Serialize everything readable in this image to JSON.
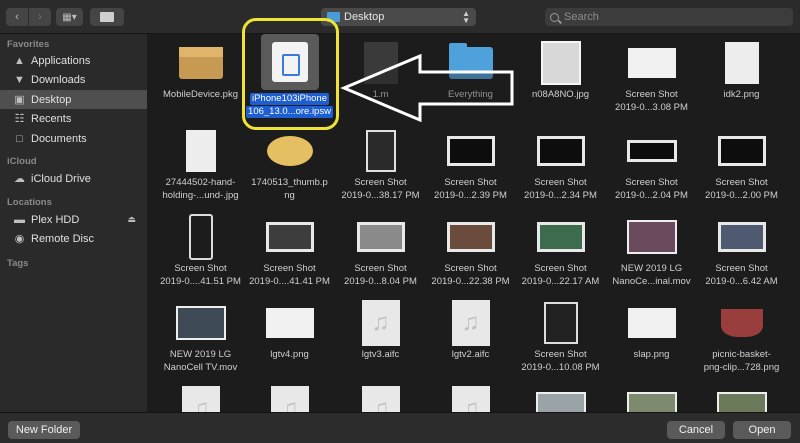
{
  "toolbar": {
    "location": "Desktop",
    "search_placeholder": "Search"
  },
  "sidebar": {
    "favorites_header": "Favorites",
    "favorites": [
      {
        "label": "Applications",
        "icon": "applications-icon"
      },
      {
        "label": "Downloads",
        "icon": "downloads-icon"
      },
      {
        "label": "Desktop",
        "icon": "desktop-icon",
        "selected": true
      },
      {
        "label": "Recents",
        "icon": "recents-icon"
      },
      {
        "label": "Documents",
        "icon": "documents-icon"
      }
    ],
    "icloud_header": "iCloud",
    "icloud": [
      {
        "label": "iCloud Drive",
        "icon": "cloud-icon"
      }
    ],
    "locations_header": "Locations",
    "locations": [
      {
        "label": "Plex HDD",
        "icon": "drive-icon"
      },
      {
        "label": "Remote Disc",
        "icon": "disc-icon"
      }
    ],
    "tags_header": "Tags"
  },
  "files": {
    "r1": [
      {
        "line1": "MobileDevice.pkg",
        "line2": ""
      },
      {
        "line1": "iPhone103iPhone",
        "line2": "106_13.0...ore.ipsw"
      },
      {
        "line1": "1.m",
        "line2": ""
      },
      {
        "line1": "Everything",
        "line2": ""
      },
      {
        "line1": "n08A8NO.jpg",
        "line2": ""
      },
      {
        "line1": "Screen Shot",
        "line2": "2019-0...3.08 PM"
      },
      {
        "line1": "idk2.png",
        "line2": ""
      }
    ],
    "r2": [
      {
        "line1": "27444502-hand-",
        "line2": "holding-...und-.jpg"
      },
      {
        "line1": "1740513_thumb.p",
        "line2": "ng"
      },
      {
        "line1": "Screen Shot",
        "line2": "2019-0...38.17 PM"
      },
      {
        "line1": "Screen Shot",
        "line2": "2019-0...2.39 PM"
      },
      {
        "line1": "Screen Shot",
        "line2": "2019-0...2.34 PM"
      },
      {
        "line1": "Screen Shot",
        "line2": "2019-0...2.04 PM"
      },
      {
        "line1": "Screen Shot",
        "line2": "2019-0...2.00 PM"
      }
    ],
    "r3": [
      {
        "line1": "Screen Shot",
        "line2": "2019-0....41.51 PM"
      },
      {
        "line1": "Screen Shot",
        "line2": "2019-0....41.41 PM"
      },
      {
        "line1": "Screen Shot",
        "line2": "2019-0...8.04 PM"
      },
      {
        "line1": "Screen Shot",
        "line2": "2019-0...22.38 PM"
      },
      {
        "line1": "Screen Shot",
        "line2": "2019-0...22.17 AM"
      },
      {
        "line1": "NEW 2019 LG",
        "line2": "NanoCe...inal.mov"
      },
      {
        "line1": "Screen Shot",
        "line2": "2019-0...6.42 AM"
      }
    ],
    "r4": [
      {
        "line1": "NEW 2019 LG",
        "line2": "NanoCell TV.mov"
      },
      {
        "line1": "lgtv4.png",
        "line2": ""
      },
      {
        "line1": "lgtv3.aifc",
        "line2": ""
      },
      {
        "line1": "lgtv2.aifc",
        "line2": ""
      },
      {
        "line1": "Screen Shot",
        "line2": "2019-0...10.08 PM"
      },
      {
        "line1": "slap.png",
        "line2": ""
      },
      {
        "line1": "picnic-basket-",
        "line2": "png-clip...728.png"
      }
    ]
  },
  "bottom": {
    "new_folder": "New Folder",
    "cancel": "Cancel",
    "open": "Open"
  },
  "colors": {
    "selection": "#1d5fd2",
    "highlight_ring": "#efe334",
    "folder": "#4fa1db"
  }
}
